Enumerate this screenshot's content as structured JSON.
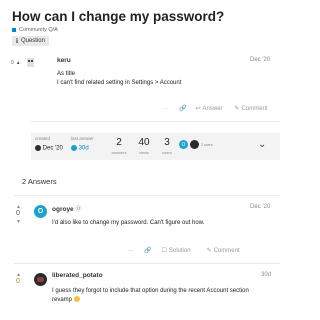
{
  "topic": {
    "title": "How can I change my password?",
    "category": "Community Q/A",
    "category_color": "#0088cc",
    "tag_icon": "i",
    "tag": "Question"
  },
  "question": {
    "vote_label": "0",
    "username": "keru",
    "date": "Dec '20",
    "lines": [
      "As title",
      "I can't find related setting in Settings > Account"
    ],
    "actions": {
      "more": "···",
      "answer": "Answer",
      "comment": "Comment"
    }
  },
  "stats": {
    "created_label": "created",
    "created_value": "Dec '20",
    "last_answer_label": "last answer",
    "last_answer_value": "30d",
    "answers_num": "2",
    "answers_cap": "answers",
    "views_num": "40",
    "views_cap": "views",
    "users_num": "3",
    "users_cap": "users",
    "avatar_letter": "O",
    "extra_label": "2 users"
  },
  "answers_header": "2 Answers",
  "answer1": {
    "vote": "0",
    "avatar_letter": "O",
    "username": "ogroye",
    "badge": "Ⓞ",
    "date": "Dec '20",
    "text": "I'd also like to change my password. Can't figure out how.",
    "actions": {
      "more": "···",
      "solution": "Solution",
      "comment": "Comment"
    }
  },
  "answer2": {
    "vote": "0",
    "username": "liberated_potato",
    "date": "30d",
    "line1": "I guess they forgot to include that option during the recent Account section",
    "line2": "revamp"
  }
}
